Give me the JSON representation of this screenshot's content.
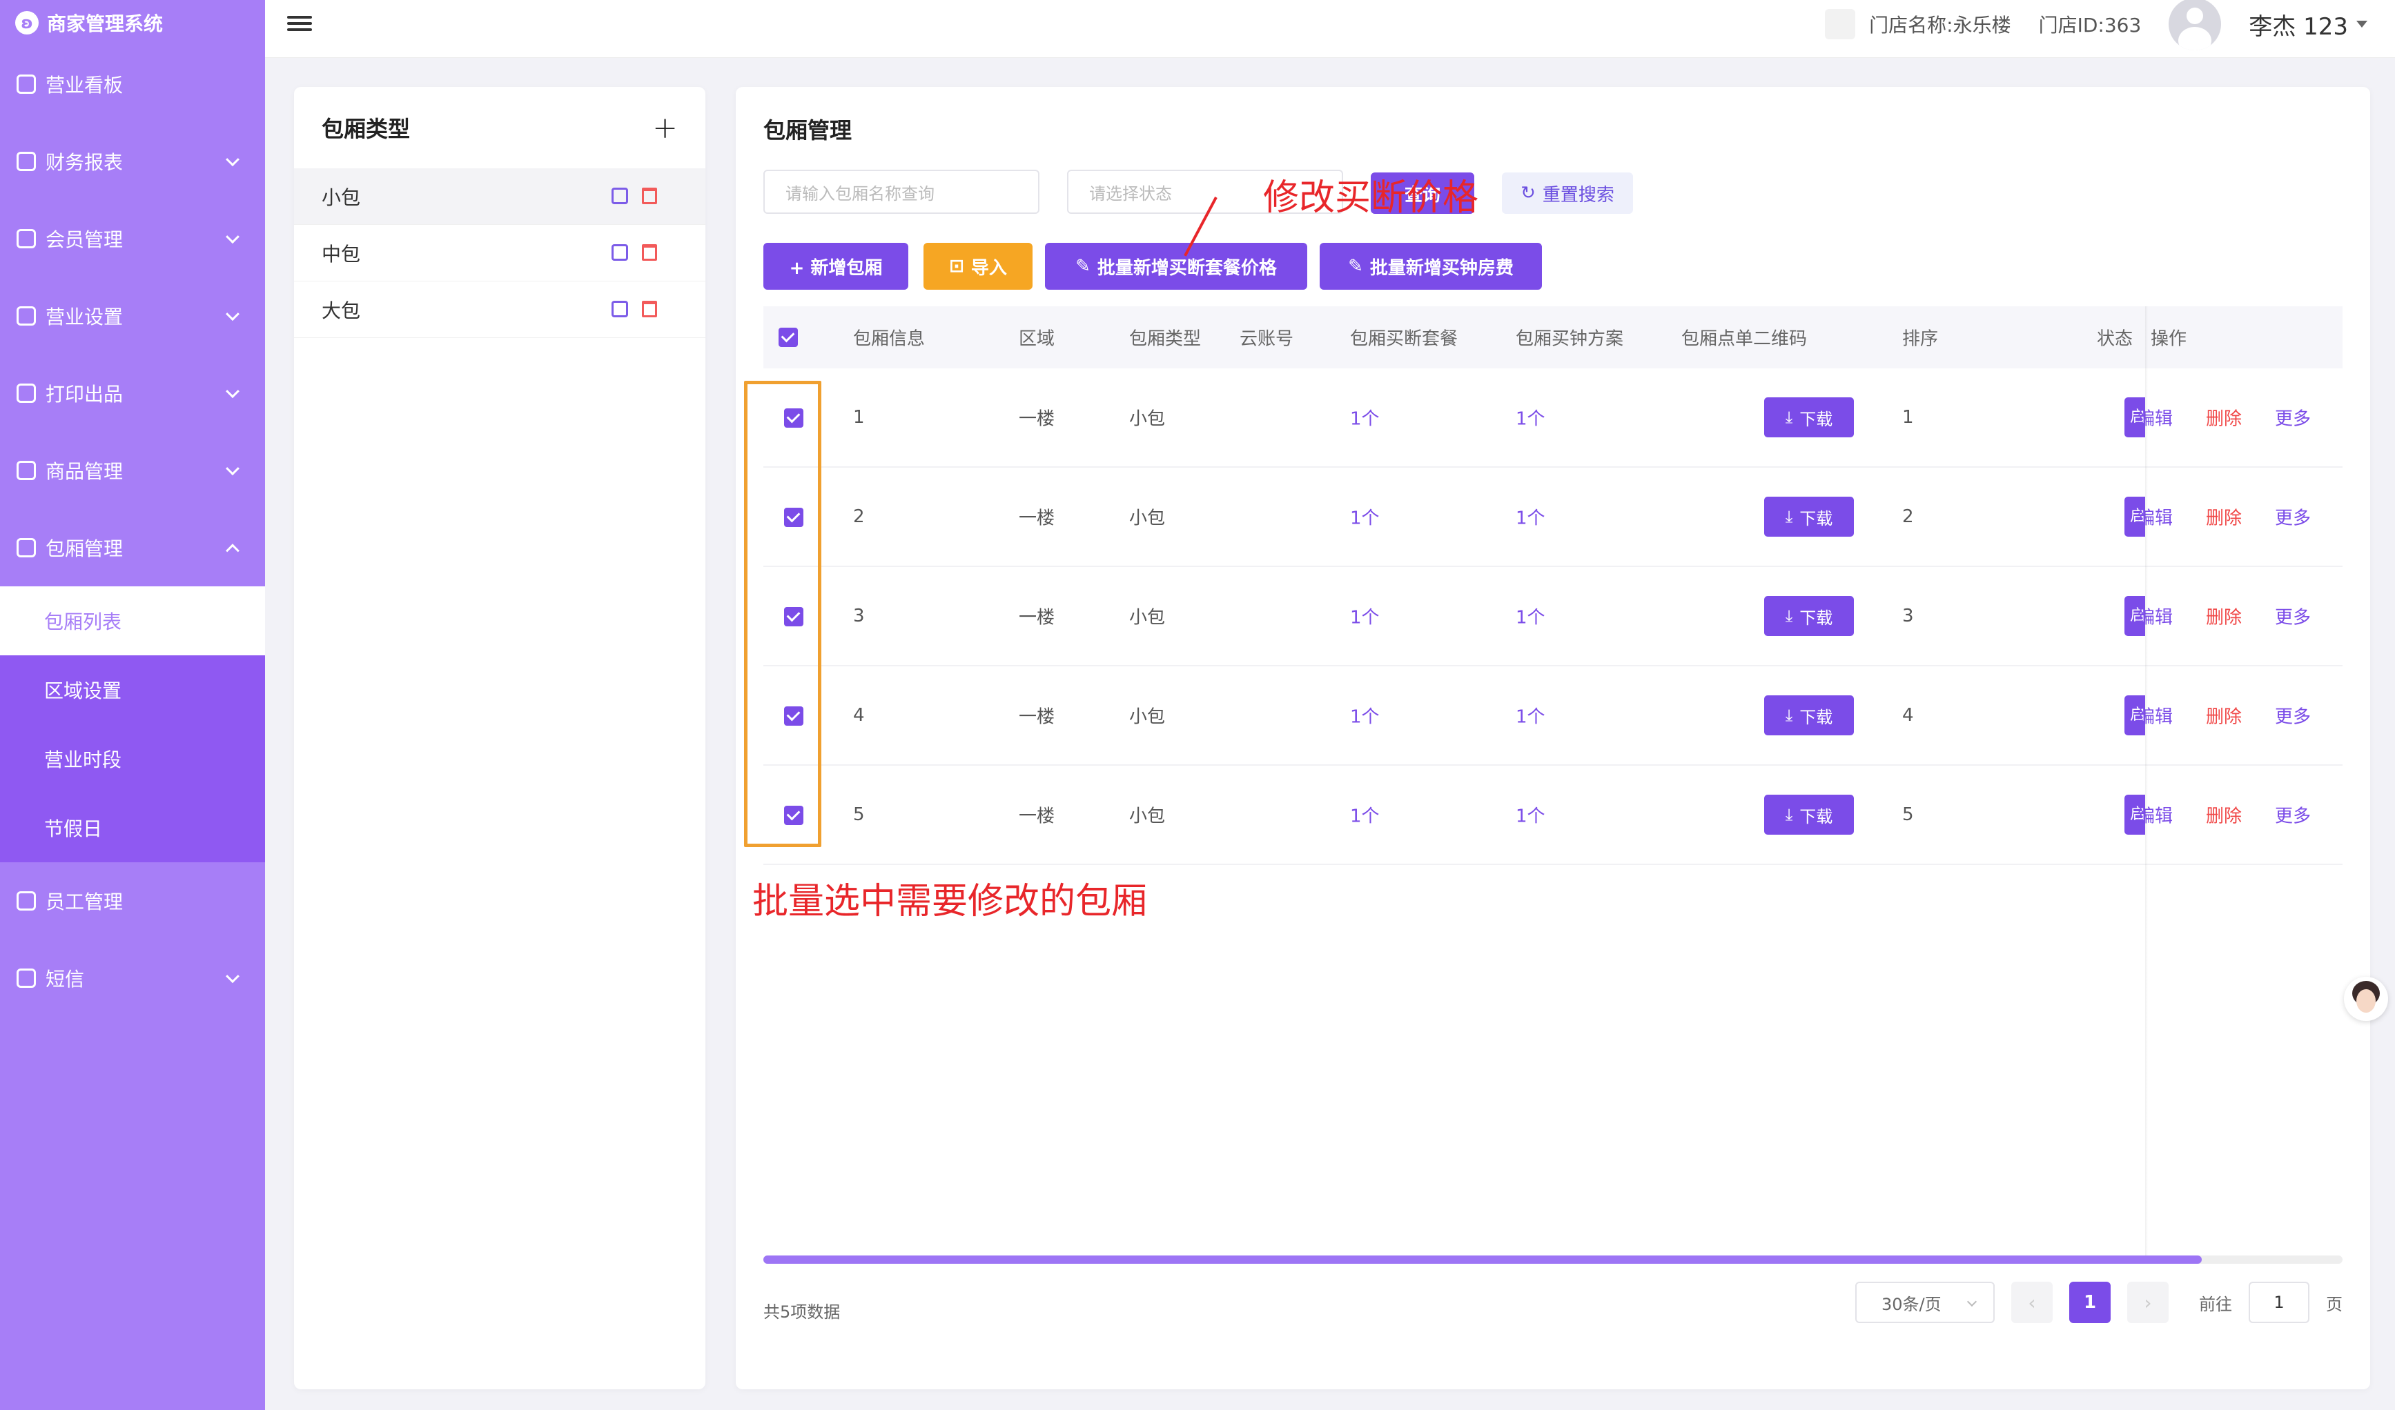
{
  "app": {
    "title": "商家管理系统"
  },
  "sidebar": {
    "items": [
      {
        "label": "营业看板",
        "icon": "home-icon",
        "expandable": false
      },
      {
        "label": "财务报表",
        "icon": "report-icon",
        "expandable": true
      },
      {
        "label": "会员管理",
        "icon": "member-icon",
        "expandable": true
      },
      {
        "label": "营业设置",
        "icon": "settings-icon",
        "expandable": true
      },
      {
        "label": "打印出品",
        "icon": "printer-icon",
        "expandable": true
      },
      {
        "label": "商品管理",
        "icon": "bag-icon",
        "expandable": true
      },
      {
        "label": "包厢管理",
        "icon": "room-icon",
        "expandable": true,
        "expanded": true
      }
    ],
    "sub_items": [
      {
        "label": "包厢列表",
        "active": true
      },
      {
        "label": "区域设置"
      },
      {
        "label": "营业时段"
      },
      {
        "label": "节假日"
      }
    ],
    "bottom_items": [
      {
        "label": "员工管理",
        "icon": "staff-icon",
        "expandable": false
      },
      {
        "label": "短信",
        "icon": "mail-icon",
        "expandable": true
      }
    ]
  },
  "topbar": {
    "store_name": "门店名称:永乐楼",
    "store_id": "门店ID:363",
    "user_name": "李杰 123"
  },
  "room_types": {
    "title": "包厢类型",
    "add": "+",
    "items": [
      {
        "label": "小包",
        "selected": true
      },
      {
        "label": "中包"
      },
      {
        "label": "大包"
      }
    ]
  },
  "main": {
    "title": "包厢管理",
    "search_placeholder": "请输入包厢名称查询",
    "status_placeholder": "请选择状态",
    "search_btn": "查询",
    "reset_btn": "重置搜索",
    "buttons": {
      "add": "+ 新增包厢",
      "import": "导入",
      "batch_buyout": "批量新增买断套餐价格",
      "batch_hourly": "批量新增买钟房费"
    },
    "columns": [
      "包厢信息",
      "区域",
      "包厢类型",
      "云账号",
      "包厢买断套餐",
      "包厢买钟方案",
      "包厢点单二维码",
      "排序",
      "状态",
      "操作"
    ],
    "rows": [
      {
        "info": "1",
        "area": "一楼",
        "type": "小包",
        "cloud": "",
        "buyout": "1个",
        "hourly": "1个",
        "qr": "下载",
        "sort": "1",
        "status": "启",
        "edit": "编辑",
        "delete": "删除",
        "more": "更多"
      },
      {
        "info": "2",
        "area": "一楼",
        "type": "小包",
        "cloud": "",
        "buyout": "1个",
        "hourly": "1个",
        "qr": "下载",
        "sort": "2",
        "status": "启",
        "edit": "编辑",
        "delete": "删除",
        "more": "更多"
      },
      {
        "info": "3",
        "area": "一楼",
        "type": "小包",
        "cloud": "",
        "buyout": "1个",
        "hourly": "1个",
        "qr": "下载",
        "sort": "3",
        "status": "启",
        "edit": "编辑",
        "delete": "删除",
        "more": "更多"
      },
      {
        "info": "4",
        "area": "一楼",
        "type": "小包",
        "cloud": "",
        "buyout": "1个",
        "hourly": "1个",
        "qr": "下载",
        "sort": "4",
        "status": "启",
        "edit": "编辑",
        "delete": "删除",
        "more": "更多"
      },
      {
        "info": "5",
        "area": "一楼",
        "type": "小包",
        "cloud": "",
        "buyout": "1个",
        "hourly": "1个",
        "qr": "下载",
        "sort": "5",
        "status": "启",
        "edit": "编辑",
        "delete": "删除",
        "more": "更多"
      }
    ],
    "total": "共5项数据",
    "page_size": "30条/页",
    "current_page": "1",
    "goto_label": "前往",
    "goto_value": "1",
    "page_unit": "页"
  },
  "annotations": {
    "top": "修改买断价格",
    "bottom": "批量选中需要修改的包厢"
  },
  "colors": {
    "sidebar": "#a77ef7",
    "primary": "#7b4ce8",
    "orange": "#f6a623",
    "danger": "#f04848",
    "annotation": "#e8262a"
  }
}
